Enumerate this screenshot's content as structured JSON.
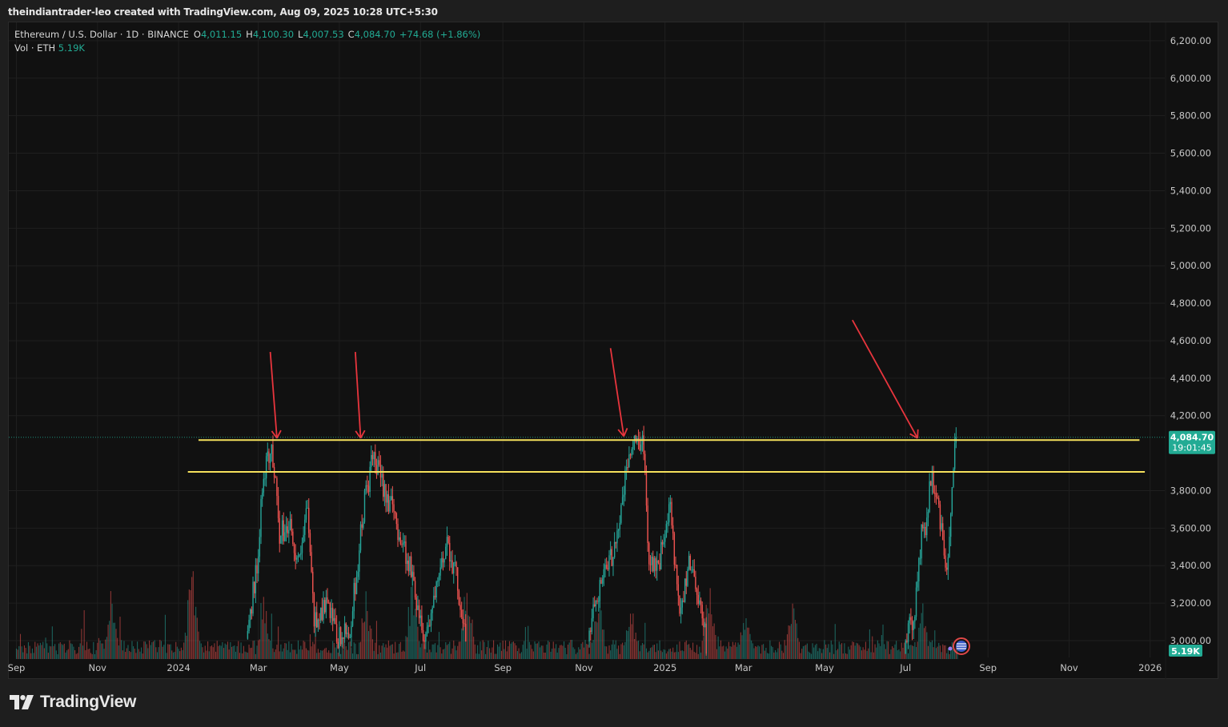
{
  "header": {
    "caption": "theindiantrader-leo created with TradingView.com, Aug 09, 2025 10:28 UTC+5:30"
  },
  "legend": {
    "symbol": "Ethereum / U.S. Dollar · 1D · BINANCE",
    "open_label": "O",
    "open": "4,011.15",
    "high_label": "H",
    "high": "4,100.30",
    "low_label": "L",
    "low": "4,007.53",
    "close_label": "C",
    "close": "4,084.70",
    "change": "+74.68 (+1.86%)",
    "vol_label": "Vol · ETH",
    "vol": "5.19K"
  },
  "brand": {
    "name": "TradingView",
    "icon": "tradingview-logo-icon"
  },
  "colors": {
    "up": "#26a69a",
    "down": "#ef5350",
    "level_line": "#f5e15c",
    "arrow": "#e8353d",
    "price_tag": "#22ab94"
  },
  "chart_data": {
    "type": "candlestick",
    "symbol": "ETHUSD",
    "interval": "1D",
    "y_axis": {
      "min": 3000,
      "max": 6200,
      "ticks": [
        "6,200.00",
        "6,000.00",
        "5,800.00",
        "5,600.00",
        "5,400.00",
        "5,200.00",
        "5,000.00",
        "4,800.00",
        "4,600.00",
        "4,400.00",
        "4,200.00",
        "3,800.00",
        "3,600.00",
        "3,400.00",
        "3,200.00",
        "3,000.00"
      ]
    },
    "x_axis": {
      "start": "2023-09-01",
      "ticks": [
        {
          "date": "2023-09-01",
          "label": "Sep"
        },
        {
          "date": "2023-11-01",
          "label": "Nov"
        },
        {
          "date": "2024-01-01",
          "label": "2024"
        },
        {
          "date": "2024-03-01",
          "label": "Mar"
        },
        {
          "date": "2024-05-01",
          "label": "May"
        },
        {
          "date": "2024-07-01",
          "label": "Jul"
        },
        {
          "date": "2024-09-01",
          "label": "Sep"
        },
        {
          "date": "2024-11-01",
          "label": "Nov"
        },
        {
          "date": "2025-01-01",
          "label": "2025"
        },
        {
          "date": "2025-03-01",
          "label": "Mar"
        },
        {
          "date": "2025-05-01",
          "label": "May"
        },
        {
          "date": "2025-07-01",
          "label": "Jul"
        },
        {
          "date": "2025-09-01",
          "label": "Sep"
        },
        {
          "date": "2025-11-01",
          "label": "Nov"
        },
        {
          "date": "2026-01-01",
          "label": "2026"
        }
      ]
    },
    "last_price": {
      "value": 4084.7,
      "label": "4,084.70",
      "countdown": "19:01:45"
    },
    "volume_label": "5.19K",
    "price_path": [
      {
        "date": "2024-02-22",
        "price": 3010
      },
      {
        "date": "2024-03-01",
        "price": 3400
      },
      {
        "date": "2024-03-06",
        "price": 3900
      },
      {
        "date": "2024-03-12",
        "price": 4070
      },
      {
        "date": "2024-03-18",
        "price": 3550
      },
      {
        "date": "2024-03-25",
        "price": 3650
      },
      {
        "date": "2024-04-02",
        "price": 3400
      },
      {
        "date": "2024-04-08",
        "price": 3700
      },
      {
        "date": "2024-04-13",
        "price": 3100
      },
      {
        "date": "2024-04-22",
        "price": 3200
      },
      {
        "date": "2024-05-01",
        "price": 3000
      },
      {
        "date": "2024-05-10",
        "price": 3050
      },
      {
        "date": "2024-05-21",
        "price": 3750
      },
      {
        "date": "2024-05-27",
        "price": 3960
      },
      {
        "date": "2024-06-05",
        "price": 3820
      },
      {
        "date": "2024-06-15",
        "price": 3600
      },
      {
        "date": "2024-06-24",
        "price": 3400
      },
      {
        "date": "2024-07-05",
        "price": 3020
      },
      {
        "date": "2024-07-14",
        "price": 3250
      },
      {
        "date": "2024-07-22",
        "price": 3550
      },
      {
        "date": "2024-07-30",
        "price": 3300
      },
      {
        "date": "2024-08-05",
        "price": 3000
      },
      {
        "date": "2024-11-05",
        "price": 3000
      },
      {
        "date": "2024-11-10",
        "price": 3200
      },
      {
        "date": "2024-11-14",
        "price": 3300
      },
      {
        "date": "2024-11-21",
        "price": 3400
      },
      {
        "date": "2024-11-29",
        "price": 3650
      },
      {
        "date": "2024-12-06",
        "price": 4000
      },
      {
        "date": "2024-12-16",
        "price": 4100
      },
      {
        "date": "2024-12-21",
        "price": 3450
      },
      {
        "date": "2024-12-28",
        "price": 3400
      },
      {
        "date": "2025-01-06",
        "price": 3700
      },
      {
        "date": "2025-01-13",
        "price": 3100
      },
      {
        "date": "2025-01-20",
        "price": 3450
      },
      {
        "date": "2025-01-27",
        "price": 3250
      },
      {
        "date": "2025-02-02",
        "price": 3000
      },
      {
        "date": "2025-07-01",
        "price": 3000
      },
      {
        "date": "2025-07-08",
        "price": 3100
      },
      {
        "date": "2025-07-14",
        "price": 3550
      },
      {
        "date": "2025-07-18",
        "price": 3650
      },
      {
        "date": "2025-07-21",
        "price": 3850
      },
      {
        "date": "2025-07-26",
        "price": 3780
      },
      {
        "date": "2025-07-30",
        "price": 3500
      },
      {
        "date": "2025-08-02",
        "price": 3380
      },
      {
        "date": "2025-08-05",
        "price": 3650
      },
      {
        "date": "2025-08-07",
        "price": 3900
      },
      {
        "date": "2025-08-09",
        "price": 4084.7
      }
    ],
    "annotations": {
      "horizontal_lines": [
        {
          "price": 4070,
          "from": "2024-01-16",
          "to": "2025-12-24",
          "color": "#f5e15c"
        },
        {
          "price": 3900,
          "from": "2024-01-08",
          "to": "2025-12-28",
          "color": "#f5e15c"
        }
      ],
      "arrows": [
        {
          "tail": {
            "date": "2024-03-10",
            "price": 4540
          },
          "head": {
            "date": "2024-03-15",
            "price": 4080
          }
        },
        {
          "tail": {
            "date": "2024-05-13",
            "price": 4540
          },
          "head": {
            "date": "2024-05-17",
            "price": 4080
          }
        },
        {
          "tail": {
            "date": "2024-11-21",
            "price": 4560
          },
          "head": {
            "date": "2024-12-01",
            "price": 4090
          }
        },
        {
          "tail": {
            "date": "2025-05-22",
            "price": 4710
          },
          "head": {
            "date": "2025-07-10",
            "price": 4080
          }
        }
      ]
    }
  }
}
